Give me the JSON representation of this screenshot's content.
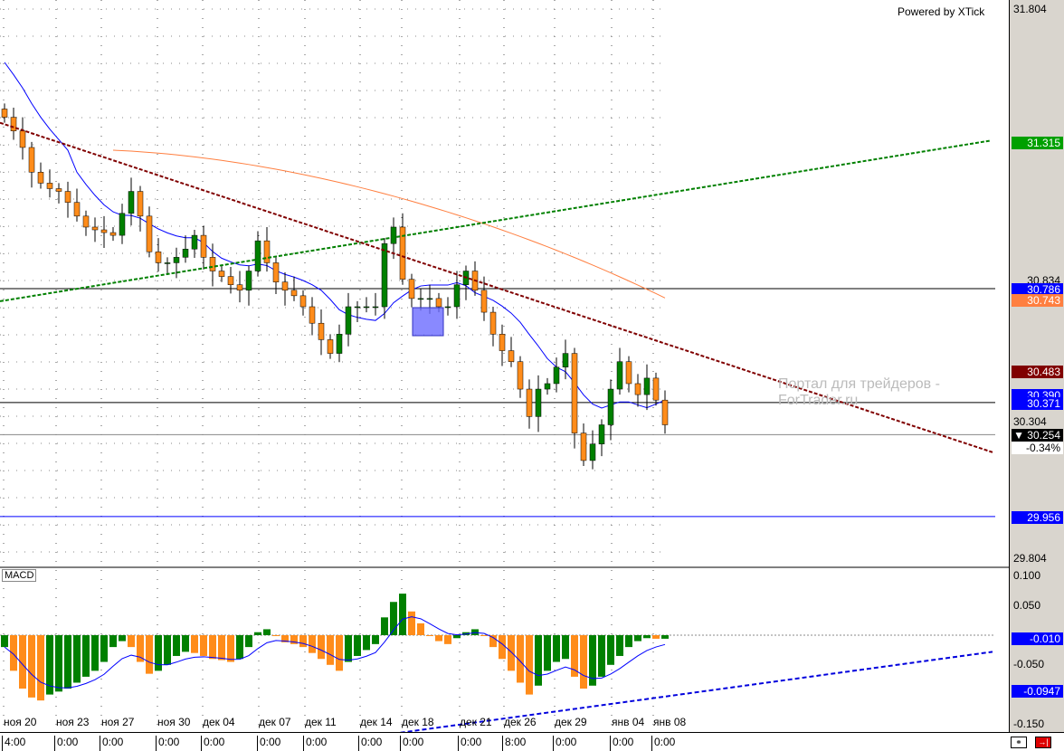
{
  "header": {
    "powered_by": "Powered by XTick",
    "watermark": "Портал для трейдеров - ForTrader.ru",
    "macd_label": "MACD"
  },
  "colors": {
    "up": "#008000",
    "down": "#ff8c1a",
    "ma_fast": "#0000ff",
    "ma_slow": "#ff7f40",
    "trend_green": "#008000",
    "trend_red": "#800000",
    "macd_trend": "#0000dd"
  },
  "price_axis": {
    "ticks": [
      "31.804",
      "30.304",
      "29.804"
    ],
    "badges": [
      {
        "label": "31.315",
        "color": "#00a000",
        "text": "#fff"
      },
      {
        "label": "30.834",
        "color": "#d9d5ce",
        "text": "#000"
      },
      {
        "label": "30.786",
        "color": "#0000ff",
        "text": "#fff"
      },
      {
        "label": "30.743",
        "color": "#ff7f40",
        "text": "#fff"
      },
      {
        "label": "30.483",
        "color": "#800000",
        "text": "#fff"
      },
      {
        "label": "30.390",
        "color": "#0000ff",
        "text": "#fff"
      },
      {
        "label": "30.371",
        "color": "#0000ff",
        "text": "#fff"
      },
      {
        "label": "▼ 30.254",
        "color": "#000",
        "text": "#fff"
      },
      {
        "label": "-0.34%",
        "color": "#fff",
        "text": "#000"
      },
      {
        "label": "29.956",
        "color": "#0000ff",
        "text": "#fff"
      }
    ]
  },
  "macd_axis": {
    "ticks": [
      "0.100",
      "0.050",
      "-0.050",
      "-0.150"
    ],
    "badges": [
      {
        "label": "-0.010",
        "color": "#0000ff",
        "text": "#fff"
      },
      {
        "label": "-0.0947",
        "color": "#0000ff",
        "text": "#fff"
      }
    ]
  },
  "x_axis": {
    "dates": [
      "ноя 20",
      "ноя 23",
      "ноя 27",
      "ноя 30",
      "дек 04",
      "дек 07",
      "дек 11",
      "дек 14",
      "дек 18",
      "дек 21",
      "дек 26",
      "дек 29",
      "янв 04",
      "янв 08"
    ],
    "times": [
      "4:00",
      "0:00",
      "0:00",
      "0:00",
      "0:00",
      "0:00",
      "0:00",
      "0:00",
      "0:00",
      "0:00",
      "8:00",
      "0:00",
      "0:00",
      "0:00"
    ]
  },
  "chart_data": {
    "type": "candlestick",
    "ylim": [
      29.804,
      31.804
    ],
    "macd_ylim": [
      -0.15,
      0.1
    ],
    "closes": [
      31.41,
      31.36,
      31.3,
      31.21,
      31.17,
      31.15,
      31.14,
      31.1,
      31.05,
      31.01,
      31.0,
      30.99,
      30.98,
      31.06,
      31.14,
      31.05,
      30.92,
      30.88,
      30.88,
      30.9,
      30.93,
      30.98,
      30.9,
      30.85,
      30.83,
      30.8,
      30.78,
      30.85,
      30.96,
      30.88,
      30.81,
      30.78,
      30.76,
      30.72,
      30.66,
      30.6,
      30.55,
      30.62,
      30.72,
      30.72,
      30.72,
      30.72,
      30.95,
      31.01,
      30.82,
      30.75,
      30.75,
      30.75,
      30.72,
      30.72,
      30.8,
      30.85,
      30.78,
      30.7,
      30.62,
      30.56,
      30.52,
      30.42,
      30.32,
      30.42,
      30.44,
      30.5,
      30.55,
      30.26,
      30.16,
      30.22,
      30.29,
      30.42,
      30.52,
      30.44,
      30.4,
      30.46,
      30.38,
      30.29
    ],
    "macd": [
      -0.02,
      -0.06,
      -0.09,
      -0.105,
      -0.11,
      -0.1,
      -0.095,
      -0.09,
      -0.08,
      -0.07,
      -0.06,
      -0.045,
      -0.02,
      -0.01,
      -0.02,
      -0.045,
      -0.065,
      -0.06,
      -0.05,
      -0.035,
      -0.028,
      -0.03,
      -0.035,
      -0.04,
      -0.042,
      -0.045,
      -0.04,
      -0.02,
      0.005,
      0.01,
      0.0,
      -0.012,
      -0.015,
      -0.02,
      -0.03,
      -0.04,
      -0.05,
      -0.06,
      -0.045,
      -0.035,
      -0.025,
      -0.015,
      0.03,
      0.056,
      0.07,
      0.04,
      0.02,
      0.0,
      -0.01,
      -0.015,
      -0.005,
      0.005,
      0.01,
      0.0,
      -0.02,
      -0.04,
      -0.06,
      -0.08,
      -0.1,
      -0.085,
      -0.06,
      -0.045,
      -0.04,
      -0.07,
      -0.09,
      -0.085,
      -0.07,
      -0.05,
      -0.035,
      -0.02,
      -0.01,
      -0.005,
      -0.006,
      -0.006
    ],
    "lines": {
      "support_29956": 29.956,
      "level_30786": 30.786,
      "level_30371": 30.371,
      "last_30254": 30.254,
      "trend_green": {
        "from": 30.74,
        "to": 31.325
      },
      "trend_red": {
        "from": 31.39,
        "to": 30.19
      },
      "macd_trend": {
        "from": -0.194,
        "to": -0.028
      }
    }
  }
}
